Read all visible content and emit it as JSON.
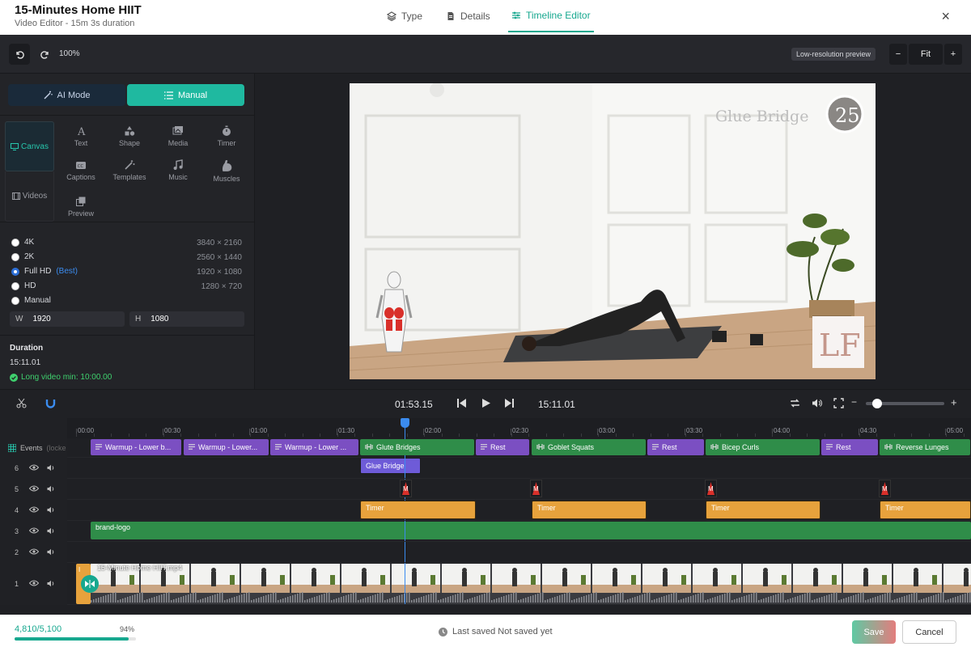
{
  "header": {
    "title": "15-Minutes Home HIIT",
    "subtitle": "Video Editor - 15m 3s duration",
    "tabs": [
      {
        "label": "Type"
      },
      {
        "label": "Details"
      },
      {
        "label": "Timeline Editor"
      }
    ],
    "close_icon": "×"
  },
  "toolbar": {
    "zoom_label": "100%",
    "low_res_label": "Low-resolution preview",
    "fit_label": "Fit",
    "minus": "−",
    "plus": "+"
  },
  "left": {
    "modes": [
      {
        "label": "AI Mode"
      },
      {
        "label": "Manual"
      }
    ],
    "sidetabs": [
      {
        "label": "Canvas"
      },
      {
        "label": "Videos"
      }
    ],
    "categories": [
      {
        "label": "Text"
      },
      {
        "label": "Shape"
      },
      {
        "label": "Media"
      },
      {
        "label": "Timer"
      },
      {
        "label": "Captions"
      },
      {
        "label": "Templates"
      },
      {
        "label": "Music"
      },
      {
        "label": "Muscles"
      },
      {
        "label": "Preview"
      }
    ],
    "resolutions": [
      {
        "label": "4K",
        "dim": "3840 × 2160"
      },
      {
        "label": "2K",
        "dim": "2560 × 1440"
      },
      {
        "label": "Full HD",
        "badge": "(Best)",
        "dim": "1920 × 1080"
      },
      {
        "label": "HD",
        "dim": "1280 × 720"
      },
      {
        "label": "Manual",
        "dim": ""
      }
    ],
    "w_label": "W",
    "w_value": "1920",
    "h_label": "H",
    "h_value": "1080",
    "duration_label": "Duration",
    "duration_value": "15:11.01",
    "long_video_note": "Long video min: 10:00.00"
  },
  "preview": {
    "overlay_title": "Glue Bridge",
    "overlay_counter": "25",
    "logo_text": "LF"
  },
  "transport": {
    "current": "01:53.15",
    "total": "15:11.01"
  },
  "ruler": {
    "ticks": [
      "00:00",
      "00:30",
      "01:00",
      "01:30",
      "02:00",
      "02:30",
      "03:00",
      "03:30",
      "04:00",
      "04:30",
      "05:00"
    ]
  },
  "tracks": {
    "events_label": "Events",
    "events_lock": "(locke",
    "events_clips": [
      {
        "label": "Warmup - Lower b..."
      },
      {
        "label": "Warmup - Lower..."
      },
      {
        "label": "Warmup - Lower ..."
      },
      {
        "label": "Glute Bridges"
      },
      {
        "label": "Rest"
      },
      {
        "label": "Goblet Squats"
      },
      {
        "label": "Rest"
      },
      {
        "label": "Bicep Curls"
      },
      {
        "label": "Rest"
      },
      {
        "label": "Reverse Lunges"
      }
    ],
    "rows": [
      {
        "num": "6"
      },
      {
        "num": "5"
      },
      {
        "num": "4"
      },
      {
        "num": "3"
      },
      {
        "num": "2"
      },
      {
        "num": "1"
      }
    ],
    "glue_bridge_clip": "Glue Bridge",
    "timer_label": "Timer",
    "brand_logo": "brand-logo",
    "video_file": "15-Minute Home HIIT.mp4",
    "muscle_marker": "M",
    "first_clip_mark": "I"
  },
  "footer": {
    "usage": "4,810/5,100",
    "percent": "94%",
    "progress": 0.94,
    "last_saved": "Last saved Not saved yet",
    "save": "Save",
    "cancel": "Cancel"
  }
}
